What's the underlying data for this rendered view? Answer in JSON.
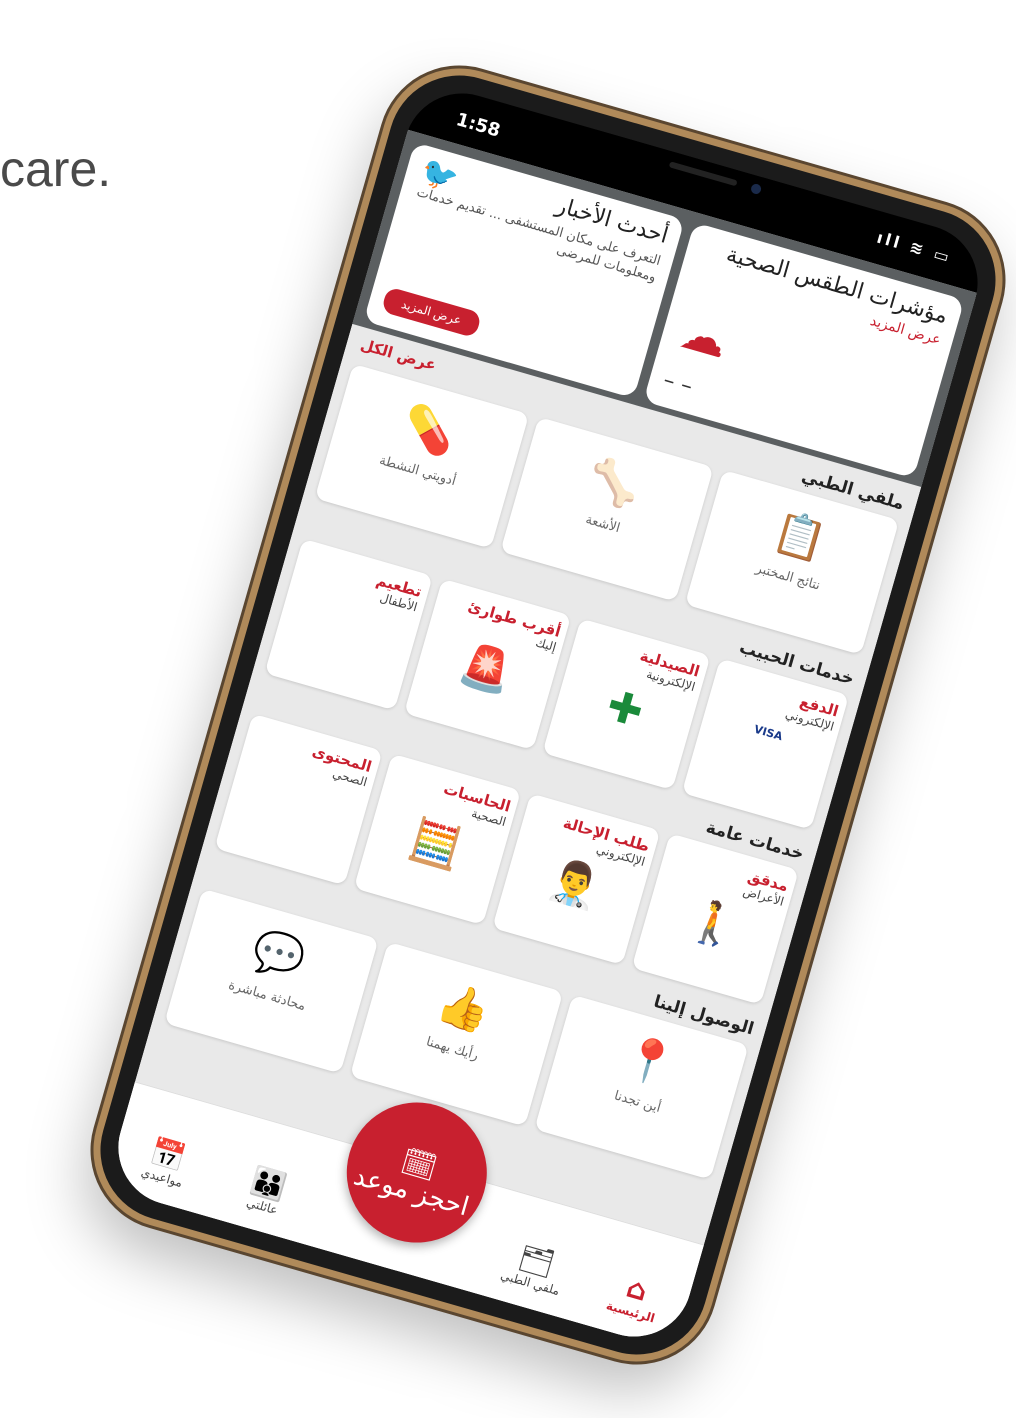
{
  "background": {
    "text": "care."
  },
  "status": {
    "time": "1:58",
    "icons": "ıll ≋ ▭"
  },
  "weather": {
    "title": "مؤشرات الطقس الصحية",
    "more": "عرض المزيد",
    "value": "– –",
    "icon": "cloud-sun-icon"
  },
  "news": {
    "title": "أحدث الأخبار",
    "text": "التعرف على مكان المستشفى ... تقديم خدمات ومعلومات للمرضى",
    "button": "عرض المزيد",
    "icon": "twitter-icon"
  },
  "medical": {
    "title": "ملفي الطبي",
    "view_all": "عرض الكل",
    "tiles": [
      {
        "label": "نتائج المختبر",
        "icon": "lab-report-icon"
      },
      {
        "label": "الأشعة",
        "icon": "xray-icon"
      },
      {
        "label": "أدويتي النشطة",
        "icon": "medicine-icon"
      }
    ]
  },
  "habib_services": {
    "title": "خدمات الحبيب",
    "tiles": [
      {
        "title": "الدفع",
        "sub": "الإلكتروني",
        "pay": "VISA"
      },
      {
        "title": "الصيدلية",
        "sub": "الإلكترونية"
      },
      {
        "title": "أقرب طوارئ",
        "sub": "إليك"
      },
      {
        "title": "تطعيم",
        "sub": "الأطفال"
      }
    ]
  },
  "general_services": {
    "title": "خدمات عامة",
    "tiles": [
      {
        "title": "مدقق",
        "sub": "الأعراض"
      },
      {
        "title": "طلب الإحالة",
        "sub": "الإلكتروني"
      },
      {
        "title": "الحاسبات",
        "sub": "الصحية"
      },
      {
        "title": "المحتوى",
        "sub": "الصحي"
      }
    ]
  },
  "contact": {
    "title": "الوصول إلينا",
    "tiles": [
      {
        "label": "أين تجدنا"
      },
      {
        "label": "رأيك يهمنا"
      },
      {
        "label": "محادثة مباشرة"
      }
    ]
  },
  "bottom_nav": {
    "home": "الرئيسية",
    "medical": "ملفي الطبي",
    "book": "احجز موعد",
    "family": "عائلتي",
    "appointments": "مواعيدي"
  }
}
